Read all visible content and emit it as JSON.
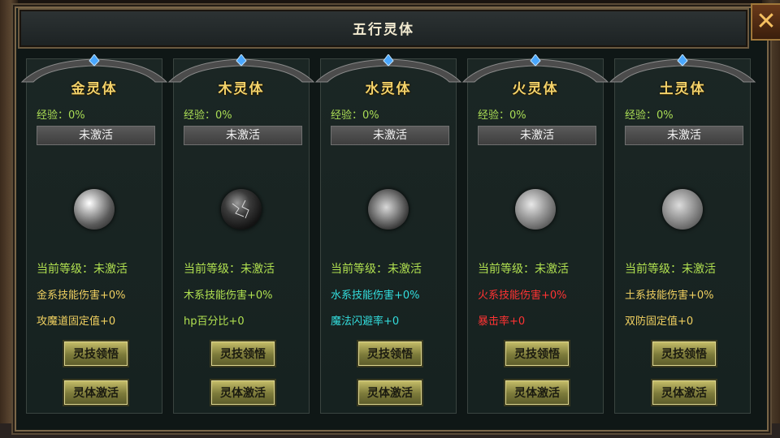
{
  "window": {
    "title": "五行灵体"
  },
  "colors": {
    "gold": "#f3d26a",
    "green": "#b0e050",
    "cyan": "#33dddd",
    "red": "#ff3333",
    "white": "#f2f2f2"
  },
  "icons": {
    "close": "close-icon"
  },
  "panels": [
    {
      "name": "金灵体",
      "exp": "经验：0%",
      "status": "未激活",
      "level": "当前等级：未激活",
      "damage": "金系技能伤害+0%",
      "damage_color": "#f0d060",
      "bonus": "攻魔道固定值+0",
      "bonus_color": "#f0d060",
      "btn_learn": "灵技领悟",
      "btn_activate": "灵体激活"
    },
    {
      "name": "木灵体",
      "exp": "经验：0%",
      "status": "未激活",
      "level": "当前等级：未激活",
      "damage": "木系技能伤害+0%",
      "damage_color": "#b0e050",
      "bonus": "hp百分比+0",
      "bonus_color": "#b0e050",
      "btn_learn": "灵技领悟",
      "btn_activate": "灵体激活"
    },
    {
      "name": "水灵体",
      "exp": "经验：0%",
      "status": "未激活",
      "level": "当前等级：未激活",
      "damage": "水系技能伤害+0%",
      "damage_color": "#33dddd",
      "bonus": "魔法闪避率+0",
      "bonus_color": "#33dddd",
      "btn_learn": "灵技领悟",
      "btn_activate": "灵体激活"
    },
    {
      "name": "火灵体",
      "exp": "经验：0%",
      "status": "未激活",
      "level": "当前等级：未激活",
      "damage": "火系技能伤害+0%",
      "damage_color": "#ff3333",
      "bonus": "暴击率+0",
      "bonus_color": "#ff3333",
      "btn_learn": "灵技领悟",
      "btn_activate": "灵体激活"
    },
    {
      "name": "土灵体",
      "exp": "经验：0%",
      "status": "未激活",
      "level": "当前等级：未激活",
      "damage": "土系技能伤害+0%",
      "damage_color": "#f0d060",
      "bonus": "双防固定值+0",
      "bonus_color": "#f0d060",
      "btn_learn": "灵技领悟",
      "btn_activate": "灵体激活"
    }
  ]
}
